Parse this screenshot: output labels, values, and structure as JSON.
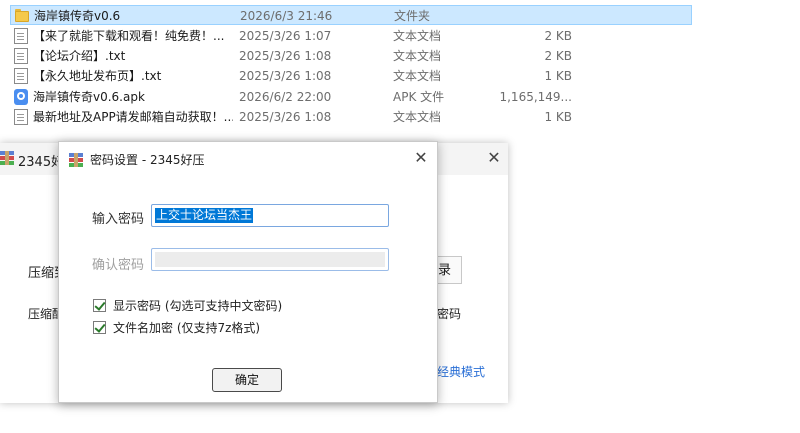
{
  "explorer": {
    "files": [
      {
        "name": "海岸镇传奇v0.6",
        "date": "2026/6/3 21:46",
        "type": "文件夹",
        "size": "",
        "icon": "folder-icon",
        "selected": true
      },
      {
        "name": "【来了就能下载和观看！纯免费！...",
        "date": "2025/3/26 1:07",
        "type": "文本文档",
        "size": "2 KB",
        "icon": "text-file-icon"
      },
      {
        "name": "【论坛介绍】.txt",
        "date": "2025/3/26 1:08",
        "type": "文本文档",
        "size": "2 KB",
        "icon": "text-file-icon"
      },
      {
        "name": "【永久地址发布页】.txt",
        "date": "2025/3/26 1:08",
        "type": "文本文档",
        "size": "1 KB",
        "icon": "text-file-icon"
      },
      {
        "name": "海岸镇传奇v0.6.apk",
        "date": "2026/6/2 22:00",
        "type": "APK 文件",
        "size": "1,165,149...",
        "icon": "apk-file-icon"
      },
      {
        "name": "最新地址及APP请发邮箱自动获取！...",
        "date": "2025/3/26 1:08",
        "type": "文本文档",
        "size": "1 KB",
        "icon": "text-file-icon"
      }
    ]
  },
  "main_window": {
    "title": "2345好",
    "close": "✕",
    "label_compress": "压缩到",
    "label_compress_method": "压缩酯",
    "button_partial": "录",
    "label_password_partial": "密码",
    "classic_mode_link": "经典模式"
  },
  "dialog": {
    "title": "密码设置 - 2345好压",
    "close": "✕",
    "password_label": "输入密码",
    "password_value": "上交士论坛当杰王",
    "confirm_label": "确认密码",
    "confirm_value": "",
    "show_password_label": "显示密码 (勾选可支持中文密码)",
    "show_password_checked": true,
    "encrypt_filename_label": "文件名加密 (仅支持7z格式)",
    "encrypt_filename_checked": true,
    "ok_button": "确定"
  },
  "colors": {
    "selection_highlight": "#0078d7",
    "row_selected": "#cce8ff",
    "link": "#2a6fd6"
  }
}
